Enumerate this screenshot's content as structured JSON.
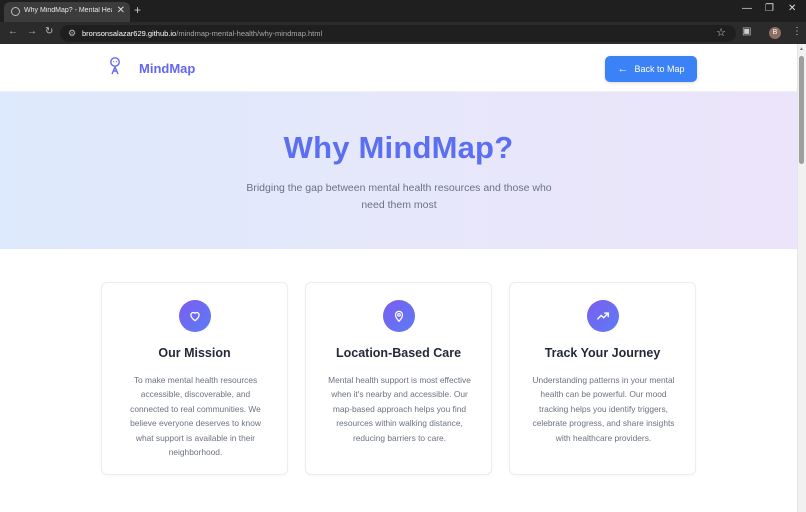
{
  "browser": {
    "tab_title": "Why MindMap? - Mental Health",
    "tab_close": "✕",
    "new_tab": "+",
    "url_host": "bronsonsalazar629.github.io",
    "url_path": "/mindmap-mental-health/why-mindmap.html",
    "profile_initial": "B"
  },
  "header": {
    "logo_text": "MindMap",
    "back_button_label": "Back to Map"
  },
  "hero": {
    "title": "Why MindMap?",
    "subtitle": "Bridging the gap between mental health resources and those who need them most"
  },
  "cards": [
    {
      "icon": "heart-icon",
      "title": "Our Mission",
      "text": "To make mental health resources accessible, discoverable, and connected to real communities. We believe everyone deserves to know what support is available in their neighborhood."
    },
    {
      "icon": "map-pin-icon",
      "title": "Location-Based Care",
      "text": "Mental health support is most effective when it's nearby and accessible. Our map-based approach helps you find resources within walking distance, reducing barriers to care."
    },
    {
      "icon": "trending-up-icon",
      "title": "Track Your Journey",
      "text": "Understanding patterns in your mental health can be powerful. Our mood tracking helps you identify triggers, celebrate progress, and share insights with healthcare providers."
    }
  ],
  "colors": {
    "brand": "#6366f1",
    "button": "#3b82f6",
    "hero_title": "#5b6ff0"
  }
}
